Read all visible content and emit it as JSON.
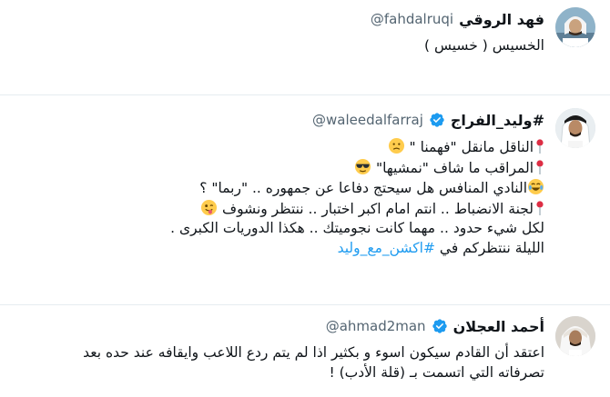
{
  "tweets": [
    {
      "name": "فهد الروقي",
      "handle": "@fahdalruqi",
      "lines": [
        "الخسيس ( خسيس )"
      ]
    },
    {
      "name": "#وليد_الفراج",
      "handle": "@waleedalfarraj",
      "verified": true,
      "lines": [
        "الناقل مانقل \"فهمنا \"",
        "المراقب ما شاف \"نمشيها\"",
        "النادي المنافس هل سيحتج دفاعا عن جمهوره .. \"ربما\" ؟",
        "لجنة الانضباط .. انتم امام اكبر اختبار .. ننتظر ونشوف",
        "لكل شيء حدود .. مهما كانت نجوميتك .. هكذا الدوريات الكبرى .",
        "الليلة ننتظركم في "
      ],
      "hashtag": "#اكشن_مع_وليد",
      "emojis": [
        "pin-icon",
        "confused-face-emoji",
        "sunglasses-face-emoji",
        "tears-of-joy-emoji",
        "winking-tongue-emoji"
      ]
    },
    {
      "name": "أحمد العجلان",
      "handle": "@ahmad2man",
      "verified": true,
      "lines": [
        "اعتقد أن القادم سيكون اسوء و بكثير اذا لم يتم ردع اللاعب وايقافه عند حده بعد",
        "تصرفاته التي اتسمت بـ (قلة الأدب) !"
      ]
    }
  ],
  "colors": {
    "verified": "#1d9bf0",
    "link": "#1d9bf0",
    "handle": "#536471",
    "separator": "#e6ecf0"
  }
}
